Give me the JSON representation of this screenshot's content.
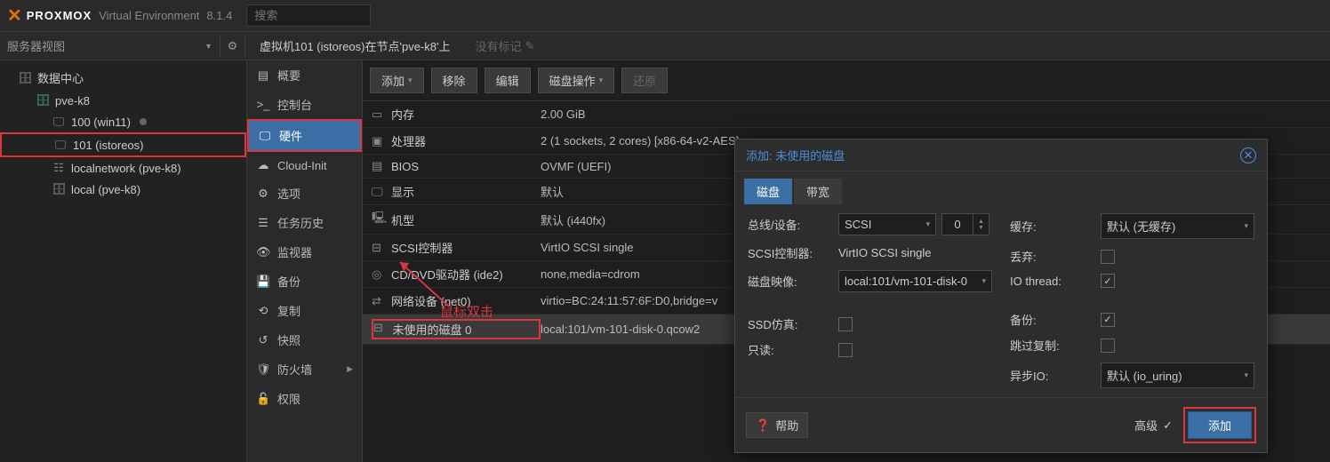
{
  "brand": {
    "name": "PROXMOX",
    "product": "Virtual Environment",
    "version": "8.1.4"
  },
  "search": {
    "placeholder": "搜索"
  },
  "view": {
    "label": "服务器视图"
  },
  "breadcrumb": "虚拟机101 (istoreos)在节点'pve-k8'上",
  "no_tags": "没有标记",
  "tree": {
    "datacenter": "数据中心",
    "node": "pve-k8",
    "vm100": "100 (win11)",
    "vm101": "101 (istoreos)",
    "net": "localnetwork (pve-k8)",
    "storage": "local (pve-k8)"
  },
  "subnav": {
    "summary": "概要",
    "console": "控制台",
    "hardware": "硬件",
    "cloudinit": "Cloud-Init",
    "options": "选项",
    "tasks": "任务历史",
    "monitor": "监视器",
    "backup": "备份",
    "replication": "复制",
    "snapshot": "快照",
    "firewall": "防火墙",
    "permissions": "权限"
  },
  "toolbar": {
    "add": "添加",
    "remove": "移除",
    "edit": "编辑",
    "diskop": "磁盘操作",
    "restore": "还原"
  },
  "hw": [
    {
      "icon": "▭",
      "label": "内存",
      "val": "2.00 GiB"
    },
    {
      "icon": "▣",
      "label": "处理器",
      "val": "2 (1 sockets, 2 cores) [x86-64-v2-AES]"
    },
    {
      "icon": "▤",
      "label": "BIOS",
      "val": "OVMF (UEFI)"
    },
    {
      "icon": "🖵",
      "label": "显示",
      "val": "默认"
    },
    {
      "icon": "🖳",
      "label": "机型",
      "val": "默认 (i440fx)"
    },
    {
      "icon": "⊟",
      "label": "SCSI控制器",
      "val": "VirtIO SCSI single"
    },
    {
      "icon": "◎",
      "label": "CD/DVD驱动器 (ide2)",
      "val": "none,media=cdrom"
    },
    {
      "icon": "⇄",
      "label": "网络设备 (net0)",
      "val": "virtio=BC:24:11:57:6F:D0,bridge=v"
    },
    {
      "icon": "⊟",
      "label": "未使用的磁盘 0",
      "val": "local:101/vm-101-disk-0.qcow2"
    }
  ],
  "annot": {
    "doubleclick": "鼠标双击"
  },
  "dialog": {
    "title": "添加: 未使用的磁盘",
    "tab_disk": "磁盘",
    "tab_bw": "带宽",
    "bus": {
      "label": "总线/设备:",
      "value": "SCSI",
      "num": "0"
    },
    "ctrl": {
      "label": "SCSI控制器:",
      "value": "VirtIO SCSI single"
    },
    "image": {
      "label": "磁盘映像:",
      "value": "local:101/vm-101-disk-0"
    },
    "ssd": {
      "label": "SSD仿真:"
    },
    "ro": {
      "label": "只读:"
    },
    "cache": {
      "label": "缓存:",
      "value": "默认 (无缓存)"
    },
    "discard": {
      "label": "丢弃:"
    },
    "iothread": {
      "label": "IO thread:"
    },
    "backup": {
      "label": "备份:"
    },
    "skiprepl": {
      "label": "跳过复制:"
    },
    "aio": {
      "label": "异步IO:",
      "value": "默认 (io_uring)"
    },
    "help": "帮助",
    "advanced": "高级",
    "submit": "添加"
  }
}
